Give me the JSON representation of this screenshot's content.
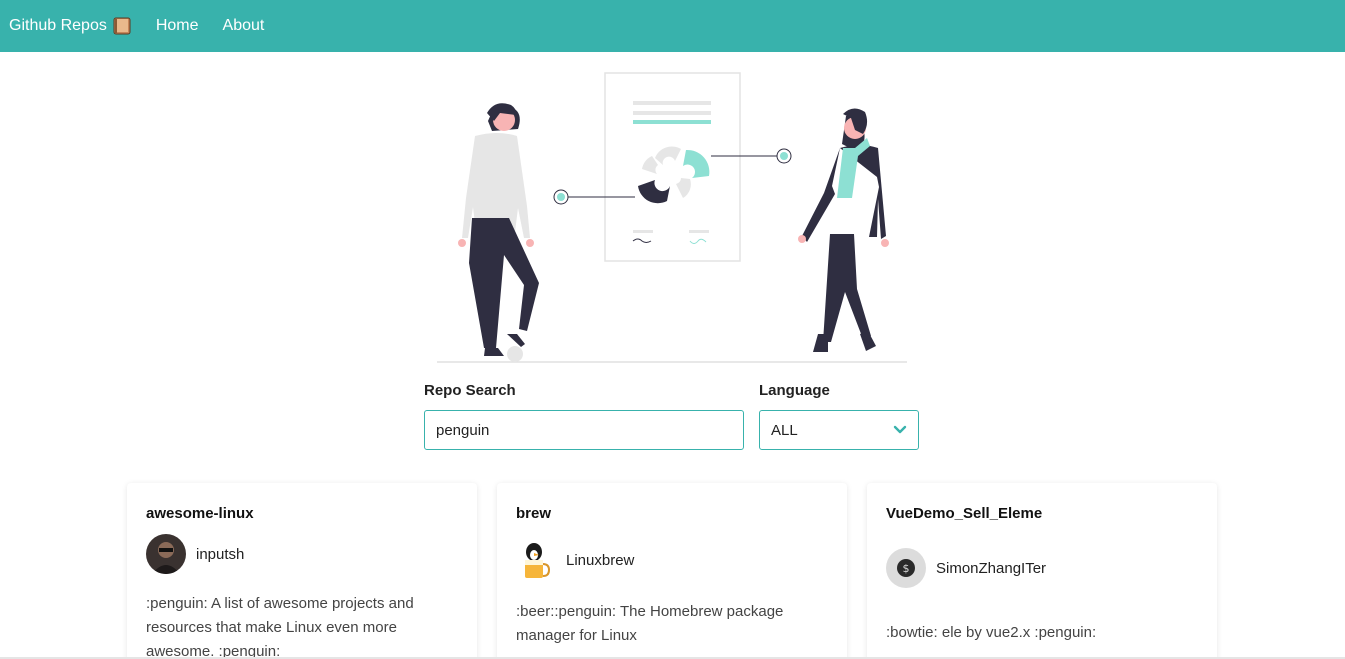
{
  "nav": {
    "brand": "Github Repos",
    "brand_icon": "book-icon",
    "links": [
      "Home",
      "About"
    ]
  },
  "search": {
    "label": "Repo Search",
    "value": "penguin"
  },
  "language": {
    "label": "Language",
    "selected": "ALL"
  },
  "cards": [
    {
      "title": "awesome-linux",
      "owner": "inputsh",
      "description": ":penguin: A list of awesome projects and resources that make Linux even more awesome. :penguin:"
    },
    {
      "title": "brew",
      "owner": "Linuxbrew",
      "description": ":beer::penguin: The Homebrew package manager for Linux"
    },
    {
      "title": "VueDemo_Sell_Eleme",
      "owner": "SimonZhangITer",
      "description": ":bowtie: ele by vue2.x :penguin:"
    }
  ],
  "colors": {
    "accent": "#38b2ac",
    "illustration_dark": "#2f2e41",
    "illustration_mint": "#8de0d3"
  }
}
